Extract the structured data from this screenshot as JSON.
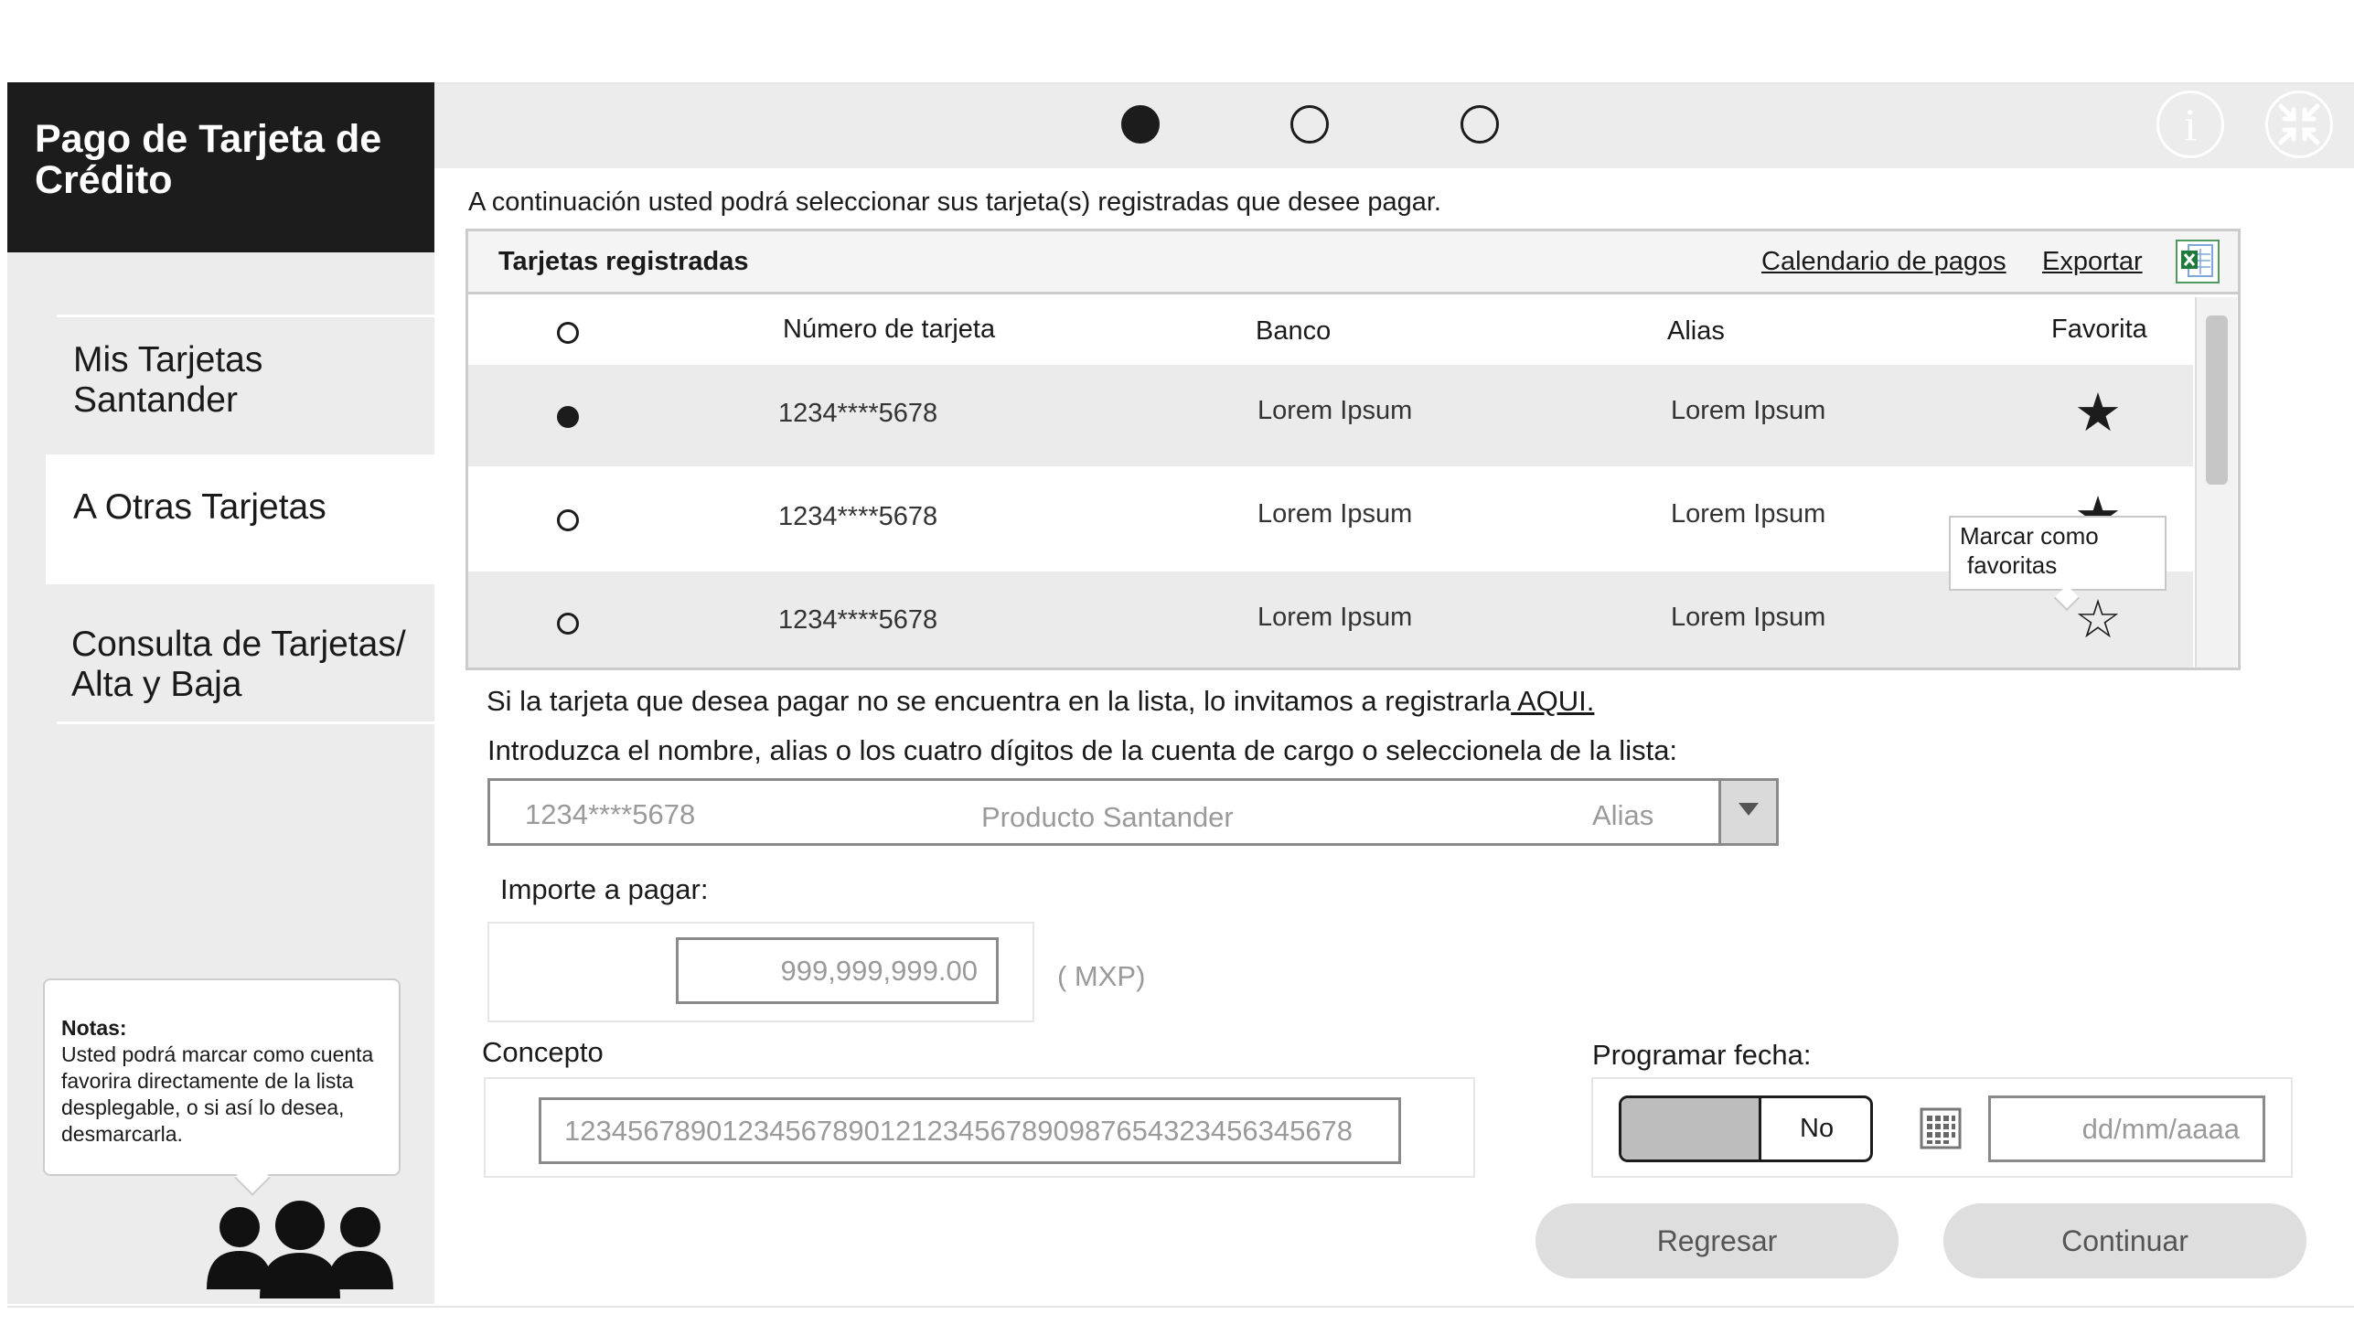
{
  "sidebar": {
    "title": "Pago de Tarjeta de Crédito",
    "items": [
      {
        "label_line1": "Mis Tarjetas",
        "label_line2": "Santander"
      },
      {
        "label_line1": "A Otras Tarjetas",
        "label_line2": ""
      },
      {
        "label_line1": "Consulta de Tarjetas/",
        "label_line2": "Alta y Baja"
      }
    ],
    "notes": {
      "heading": "Notas:",
      "body": "Usted podrá marcar como cuenta favorira directamente de la lista desplegable, o si así lo desea, desmarcarla."
    }
  },
  "steps": {
    "current": 1,
    "total": 3
  },
  "top_icons": {
    "info": "i",
    "info_icon": "info-icon",
    "collapse_icon": "collapse-icon"
  },
  "intro_text": "A continuación usted podrá seleccionar sus tarjeta(s) registradas que desee pagar.",
  "cards_table": {
    "title": "Tarjetas registradas",
    "calendar_link": "Calendario de pagos",
    "export_link": "Exportar",
    "columns": [
      "Número de tarjeta",
      "Banco",
      "Alias",
      "Favorita"
    ],
    "rows": [
      {
        "number": "1234****5678",
        "bank": "Lorem Ipsum",
        "alias": "Lorem Ipsum",
        "selected": true,
        "favorite": true
      },
      {
        "number": "1234****5678",
        "bank": "Lorem Ipsum",
        "alias": "Lorem Ipsum",
        "selected": false,
        "favorite": true
      },
      {
        "number": "1234****5678",
        "bank": "Lorem Ipsum",
        "alias": "Lorem Ipsum",
        "selected": false,
        "favorite": false
      }
    ],
    "tooltip_line1": "Marcar como",
    "tooltip_line2": "favoritas"
  },
  "register": {
    "text": "Si la tarjeta que desea pagar no se encuentra en la lista, lo invitamos a registrarla",
    "link": " AQUI."
  },
  "account_select": {
    "label": "Introduzca el nombre, alias o los cuatro dígitos de la cuenta de cargo o seleccionela de la lista:",
    "number": "1234****5678",
    "product": "Producto Santander",
    "alias": "Alias"
  },
  "amount": {
    "label": "Importe a pagar:",
    "placeholder": "999,999,999.00",
    "currency": "( MXP)"
  },
  "concept": {
    "label": "Concepto",
    "placeholder": "12345678901234567890121234567890987654323456345678"
  },
  "schedule": {
    "label": "Programar fecha:",
    "toggle_value": "No",
    "date_placeholder": "dd/mm/aaaa"
  },
  "buttons": {
    "back": "Regresar",
    "continue": "Continuar"
  },
  "colors": {
    "sidebar_header": "#1c1c1c",
    "panel_bg": "#ececec",
    "row_alt": "#ebebeb",
    "excel_green": "#1f7a3a"
  }
}
